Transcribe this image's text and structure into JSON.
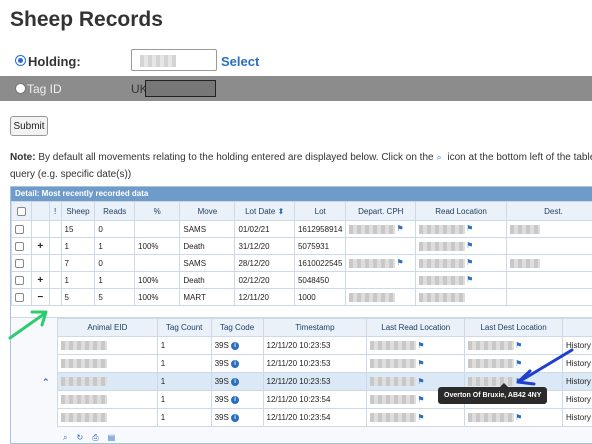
{
  "page_title": "Sheep Records",
  "holding": {
    "label": "Holding:",
    "select_label": "Select"
  },
  "tag_id": {
    "label": "Tag ID",
    "prefix": "UK"
  },
  "submit_label": "Submit",
  "note": {
    "bold": "Note:",
    "line1": " By default all movements relating to the holding entered are displayed below. Click on the",
    "icon": "magnify-icon",
    "line1b": " icon at the bottom left of the table to",
    "line2": "query (e.g. specific date(s))"
  },
  "grid": {
    "caption": "Detail: Most recently recorded data",
    "columns": [
      "",
      "",
      "!",
      "Sheep",
      "Reads",
      "%",
      "Move",
      "Lot Date",
      "Lot",
      "Depart. CPH",
      "Read Location",
      "Dest."
    ],
    "rows": [
      {
        "expander": "",
        "sheep": "15",
        "reads": "0",
        "pct": "",
        "move": "SAMS",
        "lot_date": "01/02/21",
        "lot": "1612958914"
      },
      {
        "expander": "+",
        "sheep": "1",
        "reads": "1",
        "pct": "100%",
        "move": "Death",
        "lot_date": "31/12/20",
        "lot": "5075931"
      },
      {
        "expander": "",
        "sheep": "7",
        "reads": "0",
        "pct": "",
        "move": "SAMS",
        "lot_date": "28/12/20",
        "lot": "1610022545"
      },
      {
        "expander": "+",
        "sheep": "1",
        "reads": "1",
        "pct": "100%",
        "move": "Death",
        "lot_date": "02/12/20",
        "lot": "5048450"
      },
      {
        "expander": "−",
        "sheep": "5",
        "reads": "5",
        "pct": "100%",
        "move": "MART",
        "lot_date": "12/11/20",
        "lot": "1000"
      }
    ]
  },
  "subgrid": {
    "columns": [
      "Animal EID",
      "Tag Count",
      "Tag Code",
      "Timestamp",
      "Last Read Location",
      "Last Dest Location",
      ""
    ],
    "rows": [
      {
        "tag_count": "1",
        "tag_code": "39S",
        "timestamp": "12/11/20 10:23:53",
        "history": "History"
      },
      {
        "tag_count": "1",
        "tag_code": "39S",
        "timestamp": "12/11/20 10:23:53",
        "history": "History"
      },
      {
        "tag_count": "1",
        "tag_code": "39S",
        "timestamp": "12/11/20 10:23:53",
        "history": "History"
      },
      {
        "tag_count": "1",
        "tag_code": "39S",
        "timestamp": "12/11/20 10:23:54",
        "history": "History"
      },
      {
        "tag_count": "1",
        "tag_code": "39S",
        "timestamp": "12/11/20 10:23:54",
        "history": "History"
      }
    ],
    "tooltip": "Overton Of Bruxie, AB42 4NY"
  },
  "colors": {
    "accent": "#2a6fbf",
    "grid_caption": "#6f9bcb",
    "tag_bar": "#8c8c8c",
    "arrow_green": "#2ecc71",
    "arrow_blue": "#1f3fcc"
  }
}
